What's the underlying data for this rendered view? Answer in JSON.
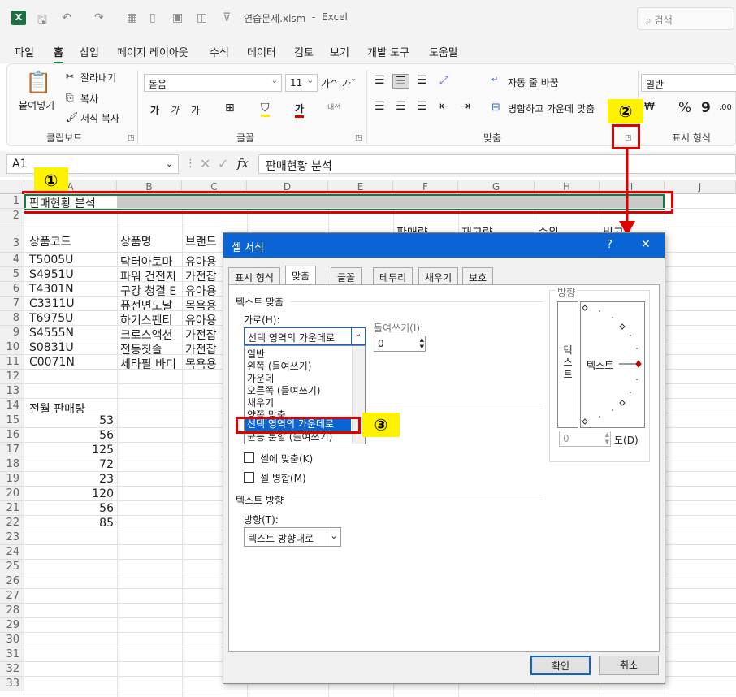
{
  "title_bar": {
    "filename": "연습문제.xlsm",
    "sep": "-",
    "app": "Excel",
    "search": "검색"
  },
  "tabs": [
    "파일",
    "홈",
    "삽입",
    "페이지 레이아웃",
    "수식",
    "데이터",
    "검토",
    "보기",
    "개발 도구",
    "도움말"
  ],
  "active_tab": "홈",
  "ribbon": {
    "clipboard": {
      "paste": "붙여넣기",
      "cut": "잘라내기",
      "copy": "복사",
      "format_painter": "서식 복사",
      "label": "클립보드"
    },
    "font": {
      "name": "돋움",
      "size": "11",
      "label": "글꼴",
      "grow": "가^",
      "shrink": "가ˇ",
      "bold": "가",
      "italic": "가",
      "underline": "가",
      "color_a": "가",
      "phonetic": "내선"
    },
    "alignment": {
      "wrap": "자동 줄 바꿈",
      "merge": "병합하고 가운데 맞춤",
      "label": "맞춤"
    },
    "number": {
      "format": "일반",
      "label": "표시 형식",
      "percent": "%",
      "comma": "9"
    }
  },
  "formula_bar": {
    "cell_ref": "A1",
    "fx": "fx",
    "content": "판매현황 분석"
  },
  "columns": [
    "A",
    "B",
    "C",
    "D",
    "E",
    "F",
    "G",
    "H",
    "I",
    "J"
  ],
  "rows": [
    "1",
    "2",
    "3",
    "4",
    "5",
    "6",
    "7",
    "8",
    "9",
    "10",
    "11",
    "12",
    "13",
    "14",
    "15",
    "16",
    "17",
    "18",
    "19",
    "20",
    "21",
    "22",
    "23",
    "24",
    "25",
    "26",
    "27",
    "28",
    "29",
    "30",
    "31",
    "32",
    "33"
  ],
  "sheet": {
    "a1": "판매현황 분석",
    "headers": {
      "a": "상품코드",
      "b": "상품명",
      "c": "브랜드",
      "f": "판매량",
      "g": "재고량",
      "h": "순위",
      "i": "비고"
    },
    "codes": [
      "T5005U",
      "S4951U",
      "T4301N",
      "C3311U",
      "T6975U",
      "S4555N",
      "S0831U",
      "C0071N"
    ],
    "names": [
      "닥터아토마",
      "파워 건전지",
      "구강 청결 E",
      "퓨전면도날",
      "하기스팬티",
      "크로스액션",
      "전동칫솔",
      "세타필 바디"
    ],
    "brands": [
      "유아용",
      "가전잡",
      "유아용",
      "목욕용",
      "유아용",
      "가전잡",
      "가전잡",
      "목욕용"
    ],
    "a14": "전월 판매량",
    "sales": [
      "53",
      "56",
      "125",
      "72",
      "23",
      "120",
      "56",
      "85"
    ]
  },
  "callouts": [
    "①",
    "②",
    "③"
  ],
  "dialog": {
    "title": "셀 서식",
    "help": "?",
    "close": "✕",
    "tabs": [
      "표시 형식",
      "맞춤",
      "글꼴",
      "테두리",
      "채우기",
      "보호"
    ],
    "text_align_section": "텍스트 맞춤",
    "horizontal_label": "가로(H):",
    "horizontal_value": "선택 영역의 가운데로",
    "indent_label": "들여쓰기(I):",
    "indent_value": "0",
    "horizontal_options": [
      "일반",
      "왼쪽 (들여쓰기)",
      "가운데",
      "오른쪽 (들여쓰기)",
      "채우기",
      "양쪽 맞춤",
      "선택 영역의 가운데로",
      "균등 분할 (들여쓰기)"
    ],
    "shrink_to_fit": "셀에 맞춤(K)",
    "merge_cells": "셀 병합(M)",
    "text_direction_section": "텍스트 방향",
    "direction_label": "방향(T):",
    "direction_value": "텍스트 방향대로",
    "orientation_section": "방향",
    "vertical_text": "텍\n스\n트",
    "orientation_text": "텍스트",
    "degree_value": "0",
    "degree_label": "도(D)",
    "ok": "확인",
    "cancel": "취소"
  }
}
